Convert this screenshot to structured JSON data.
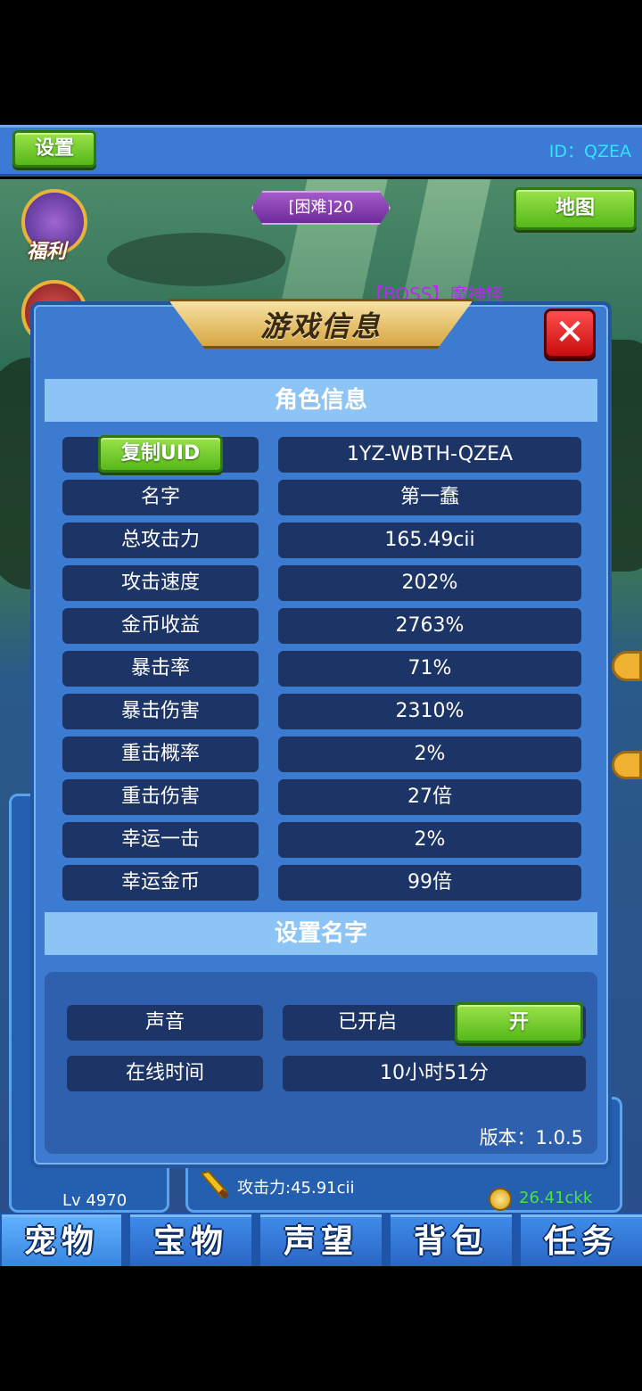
{
  "topbar": {
    "settings_label": "设置",
    "id_text": "ID：QZEA"
  },
  "scene": {
    "fuli_label": "福利",
    "stage_badge": "[困难]20",
    "map_label": "地图",
    "boss_text": "【BOSS】魔神怪"
  },
  "under_ui": {
    "level_text": "Lv 4970",
    "attack_text": "攻击力:45.91cii",
    "coin_text": "26.41ckk"
  },
  "dialog": {
    "title": "游戏信息",
    "close_glyph": "✕",
    "role_section": "角色信息",
    "copy_uid_label": "复制UID",
    "uid_value": "1YZ-WBTH-QZEA",
    "stats": [
      {
        "label": "名字",
        "value": "第一蠢"
      },
      {
        "label": "总攻击力",
        "value": "165.49cii"
      },
      {
        "label": "攻击速度",
        "value": "202%"
      },
      {
        "label": "金币收益",
        "value": "2763%"
      },
      {
        "label": "暴击率",
        "value": "71%"
      },
      {
        "label": "暴击伤害",
        "value": "2310%"
      },
      {
        "label": "重击概率",
        "value": "2%"
      },
      {
        "label": "重击伤害",
        "value": "27倍"
      },
      {
        "label": "幸运一击",
        "value": "2%"
      },
      {
        "label": "幸运金币",
        "value": "99倍"
      }
    ],
    "name_section": "设置名字",
    "sound_label": "声音",
    "sound_state": "已开启",
    "sound_toggle": "开",
    "online_label": "在线时间",
    "online_value": "10小时51分",
    "version": "版本：1.0.5"
  },
  "nav": {
    "tabs": [
      "宠物",
      "宝物",
      "声望",
      "背包",
      "任务"
    ]
  },
  "colors": {
    "panel_blue": "#3c7bd0",
    "row_dark": "#1c3466",
    "header_light": "#8cc4f6",
    "button_green": "#55b81a",
    "close_red": "#c80d0d"
  }
}
